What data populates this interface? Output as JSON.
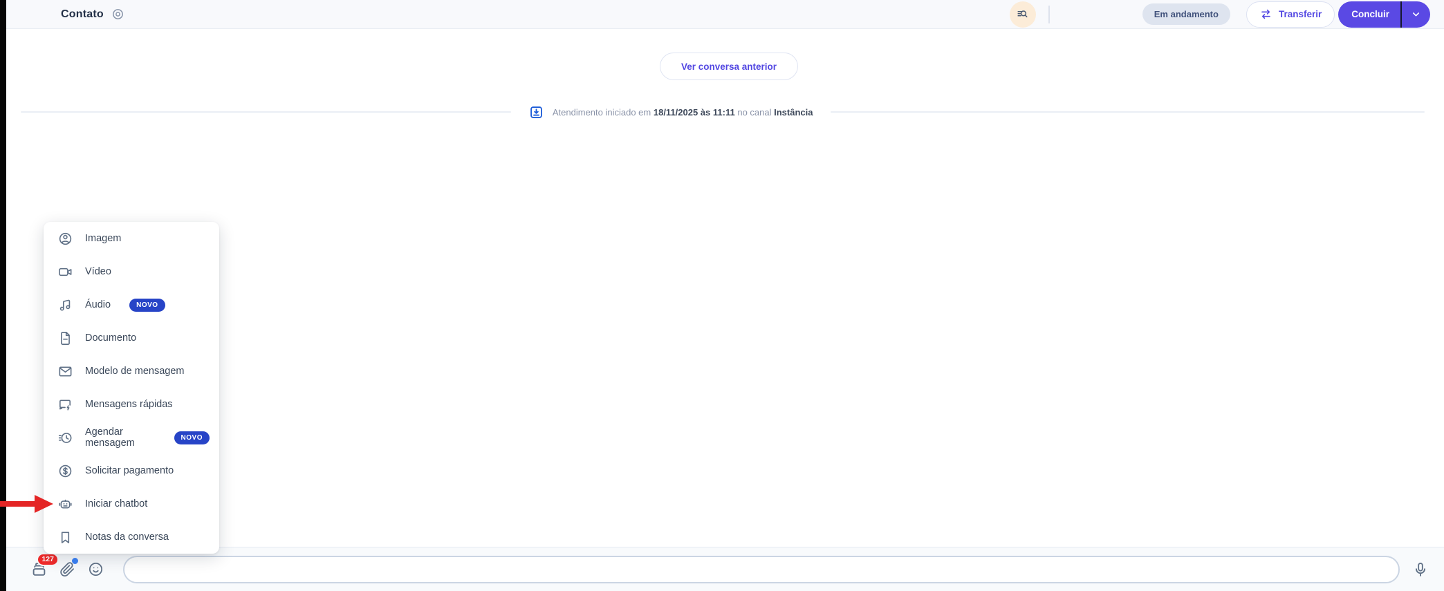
{
  "header": {
    "title": "Contato",
    "status_badge": "Em andamento",
    "transfer_label": "Transferir",
    "conclude_label": "Concluir"
  },
  "conversation": {
    "previous_conversation_button": "Ver conversa anterior",
    "system_message": {
      "prefix": "Atendimento iniciado em",
      "datetime": "18/11/2025 às 11:11",
      "connector": "no canal",
      "channel": "Instância"
    }
  },
  "attach_menu": {
    "items": [
      {
        "label": "Imagem",
        "icon": "image-icon",
        "badge": ""
      },
      {
        "label": "Vídeo",
        "icon": "video-icon",
        "badge": ""
      },
      {
        "label": "Áudio",
        "icon": "audio-icon",
        "badge": "NOVO"
      },
      {
        "label": "Documento",
        "icon": "document-icon",
        "badge": ""
      },
      {
        "label": "Modelo de mensagem",
        "icon": "message-template-icon",
        "badge": ""
      },
      {
        "label": "Mensagens rápidas",
        "icon": "quick-messages-icon",
        "badge": ""
      },
      {
        "label": "Agendar mensagem",
        "icon": "schedule-message-icon",
        "badge": "NOVO"
      },
      {
        "label": "Solicitar pagamento",
        "icon": "payment-icon",
        "badge": ""
      },
      {
        "label": "Iniciar chatbot",
        "icon": "chatbot-icon",
        "badge": ""
      },
      {
        "label": "Notas da conversa",
        "icon": "conversation-notes-icon",
        "badge": ""
      }
    ]
  },
  "composer": {
    "quick_count_badge": "127",
    "input_value": "",
    "input_placeholder": ""
  },
  "colors": {
    "accent_indigo": "#5a49e4",
    "novo_badge_blue": "#2744c7",
    "status_badge_bg": "#dee4ef",
    "status_badge_text": "#41527c",
    "notification_red": "#f22b2b",
    "annotation_arrow_red": "#e42525",
    "search_button_bg": "#fcecd8",
    "system_icon_blue": "#1d5cd8",
    "header_bg": "#f8f9fc"
  }
}
